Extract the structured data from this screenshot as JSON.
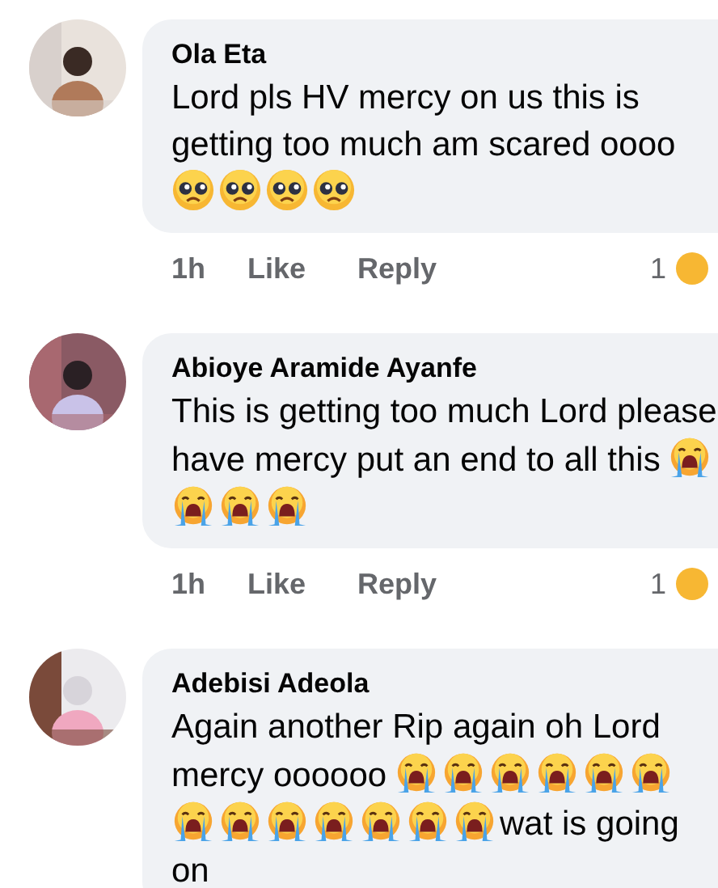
{
  "comments": [
    {
      "author": "Ola Eta",
      "body": [
        {
          "kind": "text",
          "text": "Lord pls HV mercy on us this is getting too much am scared oooo"
        },
        {
          "kind": "pleading"
        },
        {
          "kind": "pleading"
        },
        {
          "kind": "pleading"
        },
        {
          "kind": "pleading"
        }
      ],
      "time": "1h",
      "actions": [
        "Like",
        "Reply"
      ],
      "reaction_count": "1"
    },
    {
      "author": "Abioye Aramide Ayanfe",
      "body": [
        {
          "kind": "text",
          "text": "This is getting too much Lord please have mercy put an end to all this"
        },
        {
          "kind": "crying"
        },
        {
          "kind": "crying"
        },
        {
          "kind": "crying"
        },
        {
          "kind": "crying"
        }
      ],
      "time": "1h",
      "actions": [
        "Like",
        "Reply"
      ],
      "reaction_count": "1"
    },
    {
      "author": "Adebisi Adeola",
      "body": [
        {
          "kind": "text",
          "text": "Again another Rip again oh Lord mercy oooooo"
        },
        {
          "kind": "crying"
        },
        {
          "kind": "crying"
        },
        {
          "kind": "crying"
        },
        {
          "kind": "crying"
        },
        {
          "kind": "crying"
        },
        {
          "kind": "crying"
        },
        {
          "kind": "crying"
        },
        {
          "kind": "crying"
        },
        {
          "kind": "crying"
        },
        {
          "kind": "crying"
        },
        {
          "kind": "crying"
        },
        {
          "kind": "crying"
        },
        {
          "kind": "crying"
        },
        {
          "kind": "text",
          "text": "wat is going on"
        }
      ]
    }
  ]
}
